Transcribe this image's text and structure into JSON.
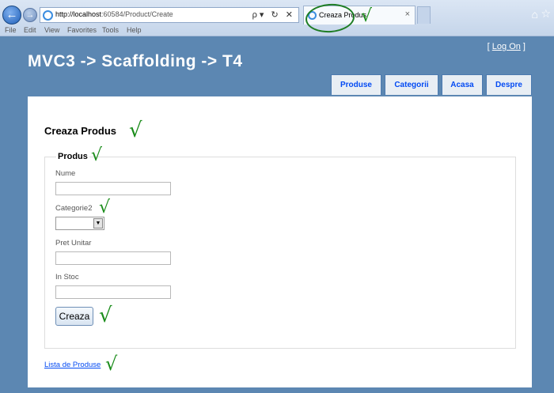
{
  "browser": {
    "url_host": "http://localhost",
    "url_rest": ":60584/Product/Create",
    "tab_title": "Creaza Produs",
    "tab_close": "×",
    "address_tools": "ρ▾ ↻ ✕",
    "menu": [
      "File",
      "Edit",
      "View",
      "Favorites",
      "Tools",
      "Help"
    ]
  },
  "header": {
    "logon_open": "[ ",
    "logon_link": "Log On",
    "logon_close": " ]",
    "site_title": "MVC3 -> Scaffolding -> T4"
  },
  "nav": [
    "Produse",
    "Categorii",
    "Acasa",
    "Despre"
  ],
  "form": {
    "page_title": "Creaza Produs",
    "legend": "Produs",
    "fields": [
      {
        "label": "Nume",
        "value": ""
      },
      {
        "label": "Categorie2",
        "value": ""
      },
      {
        "label": "Pret Unitar",
        "value": ""
      },
      {
        "label": "In Stoc",
        "value": ""
      }
    ],
    "submit_label": "Creaza",
    "back_link": "Lista de Produse"
  },
  "annotations": {
    "check_mark": "√"
  },
  "colors": {
    "page_bg": "#5c87b2",
    "link": "#034af3",
    "check": "#1a8c1a"
  }
}
